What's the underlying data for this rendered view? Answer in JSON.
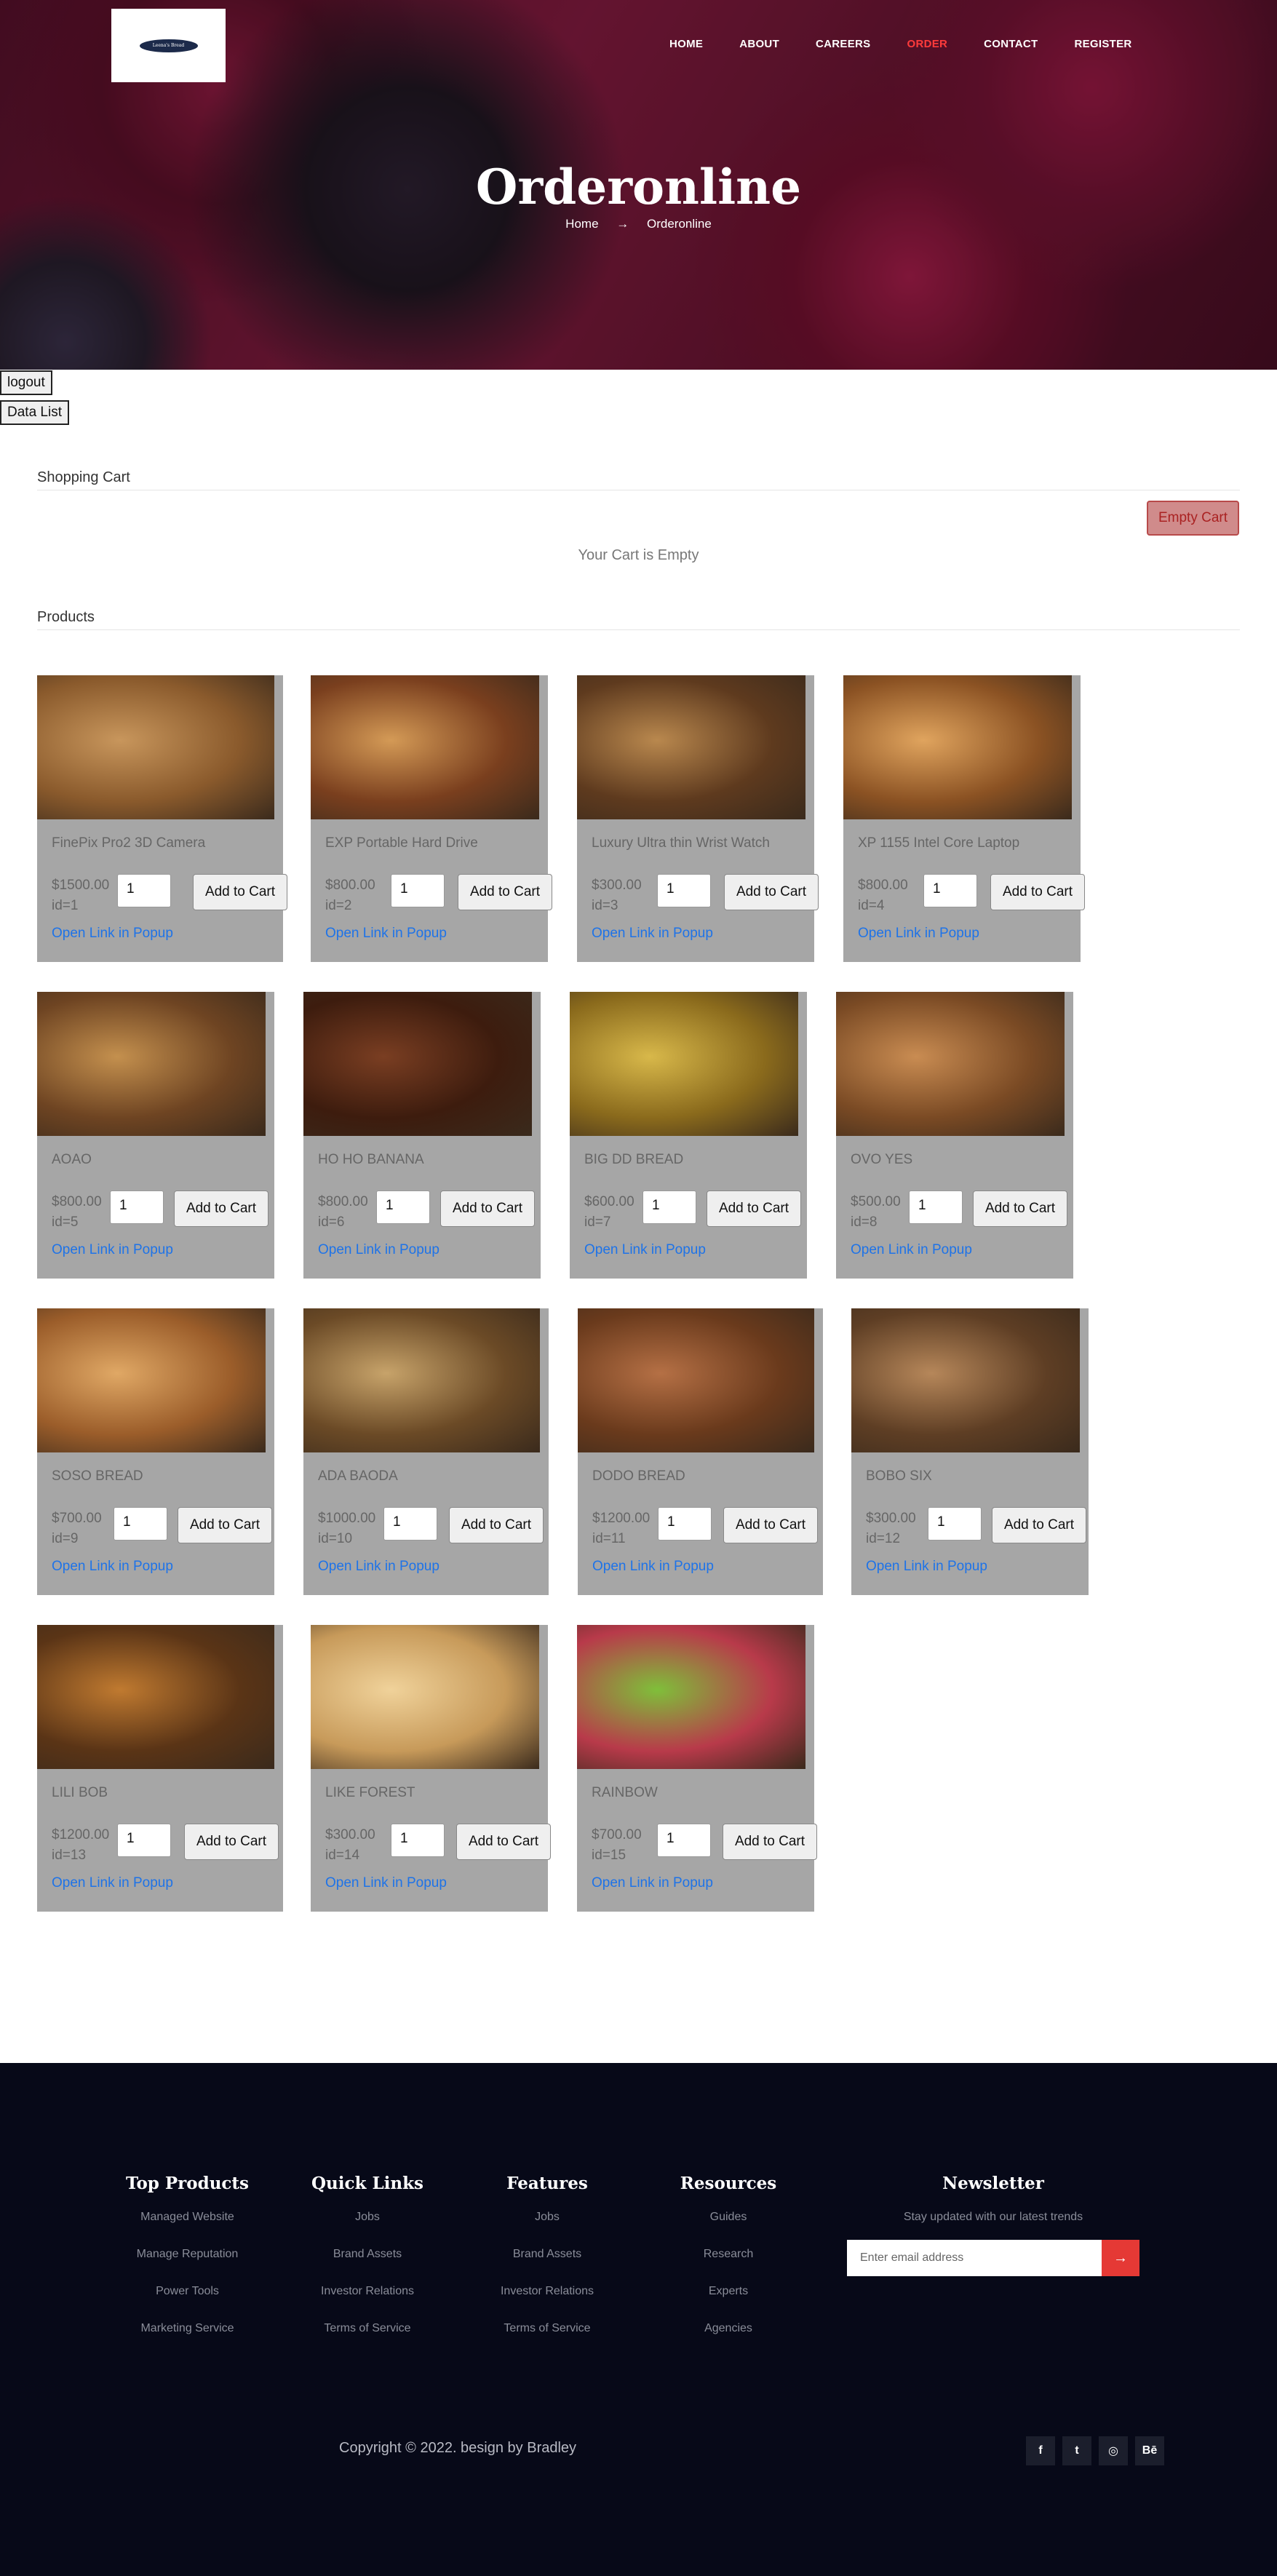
{
  "header": {
    "logo_text": "Leena's Bread",
    "nav": [
      "HOME",
      "ABOUT",
      "CAREERS",
      "ORDER",
      "CONTACT",
      "REGISTER"
    ],
    "active_nav": "ORDER",
    "title": "Orderonline",
    "breadcrumb": {
      "home": "Home",
      "arrow": "→",
      "current": "Orderonline"
    }
  },
  "controls": {
    "logout": "logout",
    "data_list": "Data List"
  },
  "cart": {
    "heading": "Shopping Cart",
    "empty_button": "Empty Cart",
    "empty_message": "Your Cart is Empty"
  },
  "products_heading": "Products",
  "products": [
    {
      "name": "FinePix Pro2 3D Camera",
      "price": "$1500.00",
      "id": "id=1",
      "qty": "1",
      "add": "Add to Cart",
      "popup": "Open Link in Popup"
    },
    {
      "name": "EXP Portable Hard Drive",
      "price": "$800.00",
      "id": "id=2",
      "qty": "1",
      "add": "Add to Cart",
      "popup": "Open Link in Popup"
    },
    {
      "name": "Luxury Ultra thin Wrist Watch",
      "price": "$300.00",
      "id": "id=3",
      "qty": "1",
      "add": "Add to Cart",
      "popup": "Open Link in Popup"
    },
    {
      "name": "XP 1155 Intel Core Laptop",
      "price": "$800.00",
      "id": "id=4",
      "qty": "1",
      "add": "Add to Cart",
      "popup": "Open Link in Popup"
    },
    {
      "name": "AOAO",
      "price": "$800.00",
      "id": "id=5",
      "qty": "1",
      "add": "Add to Cart",
      "popup": "Open Link in Popup"
    },
    {
      "name": "HO HO BANANA",
      "price": "$800.00",
      "id": "id=6",
      "qty": "1",
      "add": "Add to Cart",
      "popup": "Open Link in Popup"
    },
    {
      "name": "BIG DD BREAD",
      "price": "$600.00",
      "id": "id=7",
      "qty": "1",
      "add": "Add to Cart",
      "popup": "Open Link in Popup"
    },
    {
      "name": "OVO YES",
      "price": "$500.00",
      "id": "id=8",
      "qty": "1",
      "add": "Add to Cart",
      "popup": "Open Link in Popup"
    },
    {
      "name": "SOSO BREAD",
      "price": "$700.00",
      "id": "id=9",
      "qty": "1",
      "add": "Add to Cart",
      "popup": "Open Link in Popup"
    },
    {
      "name": "ADA BAODA",
      "price": "$1000.00",
      "id": "id=10",
      "qty": "1",
      "add": "Add to Cart",
      "popup": "Open Link in Popup"
    },
    {
      "name": "DODO BREAD",
      "price": "$1200.00",
      "id": "id=11",
      "qty": "1",
      "add": "Add to Cart",
      "popup": "Open Link in Popup"
    },
    {
      "name": "BOBO SIX",
      "price": "$300.00",
      "id": "id=12",
      "qty": "1",
      "add": "Add to Cart",
      "popup": "Open Link in Popup"
    },
    {
      "name": "LILI BOB",
      "price": "$1200.00",
      "id": "id=13",
      "qty": "1",
      "add": "Add to Cart",
      "popup": "Open Link in Popup"
    },
    {
      "name": "LIKE FOREST",
      "price": "$300.00",
      "id": "id=14",
      "qty": "1",
      "add": "Add to Cart",
      "popup": "Open Link in Popup"
    },
    {
      "name": "RAINBOW",
      "price": "$700.00",
      "id": "id=15",
      "qty": "1",
      "add": "Add to Cart",
      "popup": "Open Link in Popup"
    }
  ],
  "footer": {
    "columns": [
      {
        "title": "Top Products",
        "items": [
          "Managed Website",
          "Manage Reputation",
          "Power Tools",
          "Marketing Service"
        ]
      },
      {
        "title": "Quick Links",
        "items": [
          "Jobs",
          "Brand Assets",
          "Investor Relations",
          "Terms of Service"
        ]
      },
      {
        "title": "Features",
        "items": [
          "Jobs",
          "Brand Assets",
          "Investor Relations",
          "Terms of Service"
        ]
      },
      {
        "title": "Resources",
        "items": [
          "Guides",
          "Research",
          "Experts",
          "Agencies"
        ]
      }
    ],
    "newsletter": {
      "title": "Newsletter",
      "text": "Stay updated with our latest trends",
      "placeholder": "Enter email address",
      "button_icon": "→"
    },
    "copyright": "Copyright © 2022. besign by Bradley",
    "social": [
      "f",
      "t",
      "◎",
      "Bē"
    ],
    "social_icons": [
      "facebook-icon",
      "twitter-icon",
      "dribbble-icon",
      "behance-icon"
    ]
  }
}
